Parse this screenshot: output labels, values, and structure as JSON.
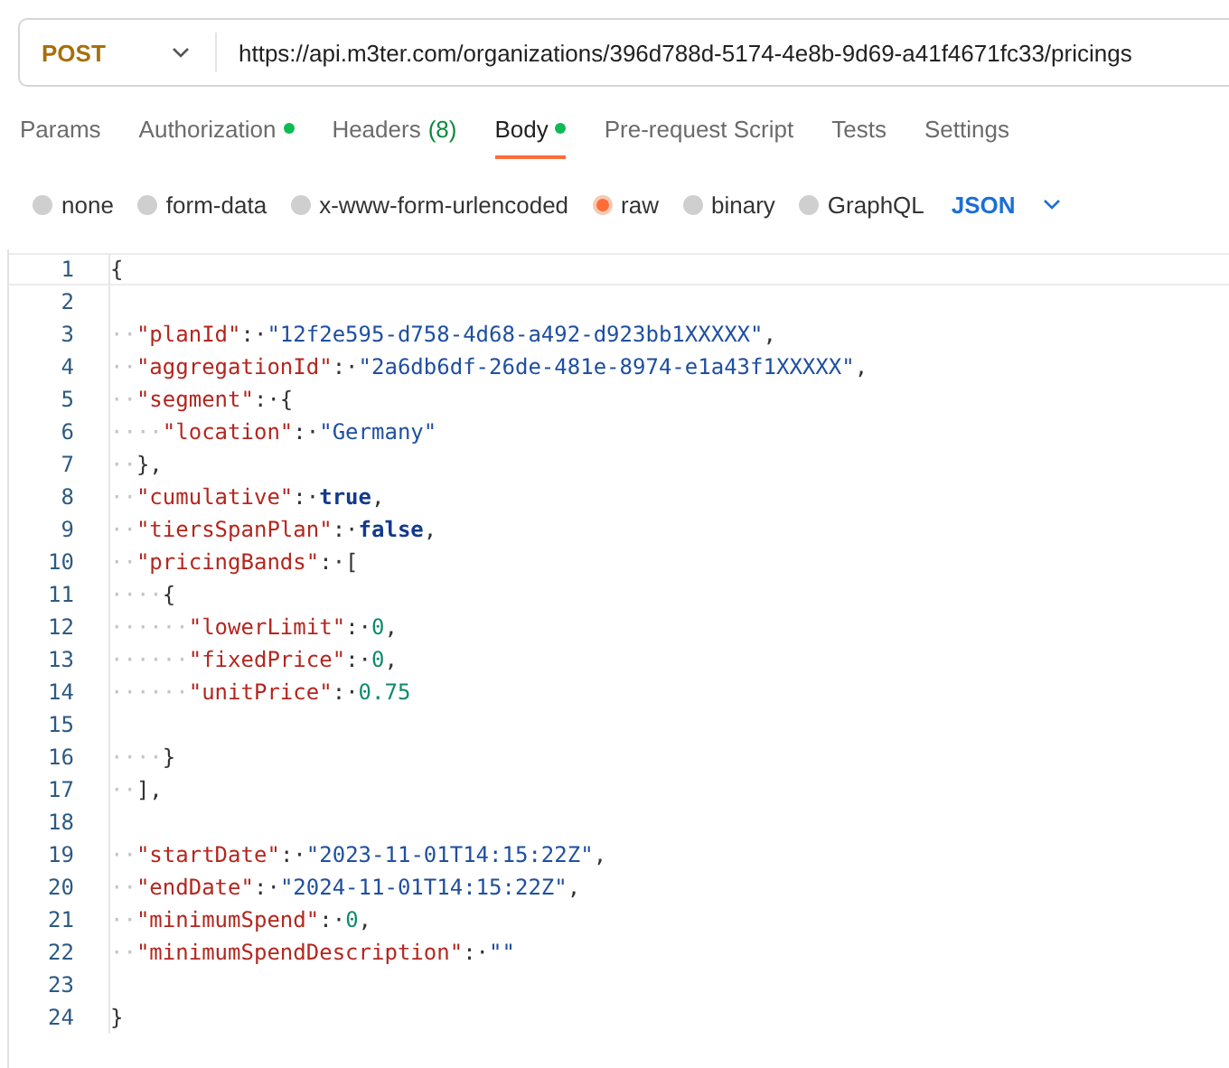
{
  "request": {
    "method": "POST",
    "url": "https://api.m3ter.com/organizations/396d788d-5174-4e8b-9d69-a41f4671fc33/pricings"
  },
  "tabs": [
    {
      "label": "Params",
      "selected": false
    },
    {
      "label": "Authorization",
      "selected": false,
      "dot": true
    },
    {
      "label": "Headers",
      "count": "(8)",
      "selected": false
    },
    {
      "label": "Body",
      "selected": true,
      "dot": true
    },
    {
      "label": "Pre-request Script",
      "selected": false
    },
    {
      "label": "Tests",
      "selected": false
    },
    {
      "label": "Settings",
      "selected": false
    }
  ],
  "body_types": [
    {
      "label": "none",
      "selected": false
    },
    {
      "label": "form-data",
      "selected": false
    },
    {
      "label": "x-www-form-urlencoded",
      "selected": false
    },
    {
      "label": "raw",
      "selected": true
    },
    {
      "label": "binary",
      "selected": false
    },
    {
      "label": "GraphQL",
      "selected": false
    }
  ],
  "format": "JSON",
  "editor": {
    "lines": [
      {
        "number": "1",
        "tokens": [
          {
            "kind": "punct",
            "text": "{"
          }
        ]
      },
      {
        "number": "2"
      },
      {
        "number": "3",
        "indent": "··",
        "tokens": [
          {
            "kind": "key",
            "text": "\"planId\""
          },
          {
            "kind": "punct",
            "text": ":·"
          },
          {
            "kind": "string",
            "text": "\"12f2e595-d758-4d68-a492-d923bb1XXXXX\""
          },
          {
            "kind": "punct",
            "text": ","
          }
        ]
      },
      {
        "number": "4",
        "indent": "··",
        "tokens": [
          {
            "kind": "key",
            "text": "\"aggregationId\""
          },
          {
            "kind": "punct",
            "text": ":·"
          },
          {
            "kind": "string",
            "text": "\"2a6db6df-26de-481e-8974-e1a43f1XXXXX\""
          },
          {
            "kind": "punct",
            "text": ","
          }
        ]
      },
      {
        "number": "5",
        "indent": "··",
        "tokens": [
          {
            "kind": "key",
            "text": "\"segment\""
          },
          {
            "kind": "punct",
            "text": ":·{"
          }
        ]
      },
      {
        "number": "6",
        "indent": "····",
        "tokens": [
          {
            "kind": "key",
            "text": "\"location\""
          },
          {
            "kind": "punct",
            "text": ":·"
          },
          {
            "kind": "string",
            "text": "\"Germany\""
          }
        ]
      },
      {
        "number": "7",
        "indent": "··",
        "tokens": [
          {
            "kind": "punct",
            "text": "},"
          }
        ]
      },
      {
        "number": "8",
        "indent": "··",
        "tokens": [
          {
            "kind": "key",
            "text": "\"cumulative\""
          },
          {
            "kind": "punct",
            "text": ":·"
          },
          {
            "kind": "keyword",
            "text": "true"
          },
          {
            "kind": "punct",
            "text": ","
          }
        ]
      },
      {
        "number": "9",
        "indent": "··",
        "tokens": [
          {
            "kind": "key",
            "text": "\"tiersSpanPlan\""
          },
          {
            "kind": "punct",
            "text": ":·"
          },
          {
            "kind": "keyword",
            "text": "false"
          },
          {
            "kind": "punct",
            "text": ","
          }
        ]
      },
      {
        "number": "10",
        "indent": "··",
        "tokens": [
          {
            "kind": "key",
            "text": "\"pricingBands\""
          },
          {
            "kind": "punct",
            "text": ":·["
          }
        ]
      },
      {
        "number": "11",
        "indent": "····",
        "tokens": [
          {
            "kind": "punct",
            "text": "{"
          }
        ]
      },
      {
        "number": "12",
        "indent": "······",
        "tokens": [
          {
            "kind": "key",
            "text": "\"lowerLimit\""
          },
          {
            "kind": "punct",
            "text": ":·"
          },
          {
            "kind": "number",
            "text": "0"
          },
          {
            "kind": "punct",
            "text": ","
          }
        ]
      },
      {
        "number": "13",
        "indent": "······",
        "tokens": [
          {
            "kind": "key",
            "text": "\"fixedPrice\""
          },
          {
            "kind": "punct",
            "text": ":·"
          },
          {
            "kind": "number",
            "text": "0"
          },
          {
            "kind": "punct",
            "text": ","
          }
        ]
      },
      {
        "number": "14",
        "indent": "······",
        "tokens": [
          {
            "kind": "key",
            "text": "\"unitPrice\""
          },
          {
            "kind": "punct",
            "text": ":·"
          },
          {
            "kind": "number",
            "text": "0.75"
          }
        ]
      },
      {
        "number": "15"
      },
      {
        "number": "16",
        "indent": "····",
        "tokens": [
          {
            "kind": "punct",
            "text": "}"
          }
        ]
      },
      {
        "number": "17",
        "indent": "··",
        "tokens": [
          {
            "kind": "punct",
            "text": "],"
          }
        ]
      },
      {
        "number": "18"
      },
      {
        "number": "19",
        "indent": "··",
        "tokens": [
          {
            "kind": "key",
            "text": "\"startDate\""
          },
          {
            "kind": "punct",
            "text": ":·"
          },
          {
            "kind": "string",
            "text": "\"2023-11-01T14:15:22Z\""
          },
          {
            "kind": "punct",
            "text": ","
          }
        ]
      },
      {
        "number": "20",
        "indent": "··",
        "tokens": [
          {
            "kind": "key",
            "text": "\"endDate\""
          },
          {
            "kind": "punct",
            "text": ":·"
          },
          {
            "kind": "string",
            "text": "\"2024-11-01T14:15:22Z\""
          },
          {
            "kind": "punct",
            "text": ","
          }
        ]
      },
      {
        "number": "21",
        "indent": "··",
        "tokens": [
          {
            "kind": "key",
            "text": "\"minimumSpend\""
          },
          {
            "kind": "punct",
            "text": ":·"
          },
          {
            "kind": "number",
            "text": "0"
          },
          {
            "kind": "punct",
            "text": ","
          }
        ]
      },
      {
        "number": "22",
        "indent": "··",
        "tokens": [
          {
            "kind": "key",
            "text": "\"minimumSpendDescription\""
          },
          {
            "kind": "punct",
            "text": ":·"
          },
          {
            "kind": "string",
            "text": "\"\""
          }
        ]
      },
      {
        "number": "23"
      },
      {
        "number": "24",
        "tokens": [
          {
            "kind": "punct",
            "text": "}"
          }
        ]
      }
    ]
  }
}
